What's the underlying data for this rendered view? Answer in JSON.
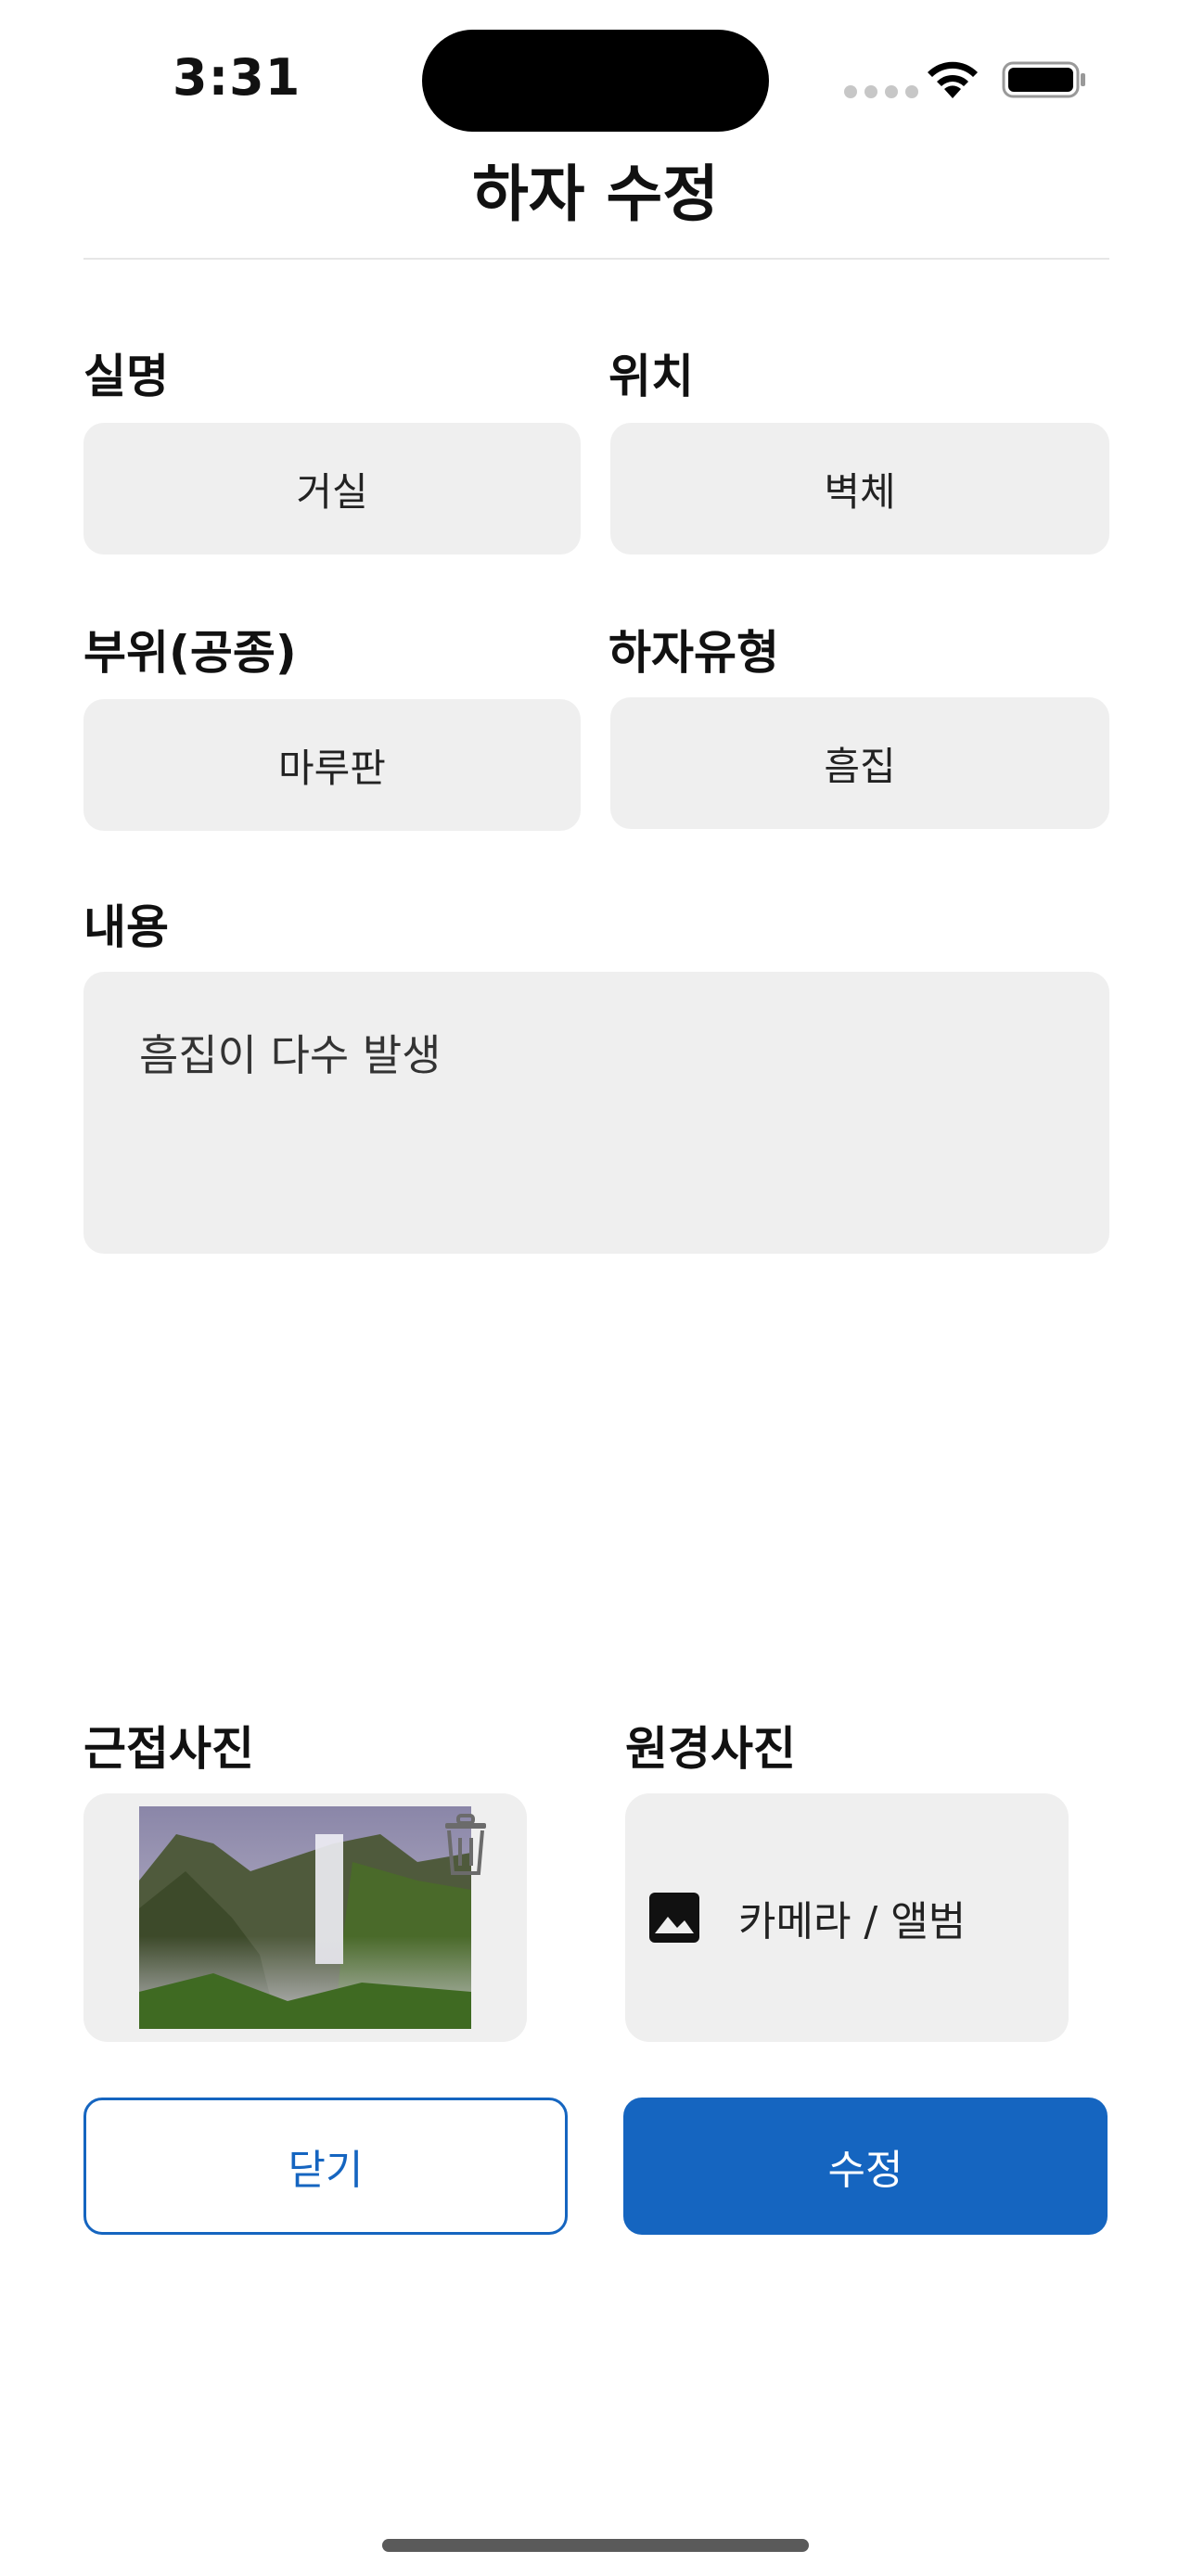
{
  "status_bar": {
    "time": "3:31"
  },
  "header": {
    "title": "하자 수정"
  },
  "form": {
    "room": {
      "label": "실명",
      "value": "거실"
    },
    "location": {
      "label": "위치",
      "value": "벽체"
    },
    "part": {
      "label": "부위(공종)",
      "value": "마루판"
    },
    "defect_type": {
      "label": "하자유형",
      "value": "흠집"
    },
    "content": {
      "label": "내용",
      "value": "흠집이 다수 발생"
    }
  },
  "photos": {
    "closeup": {
      "label": "근접사진"
    },
    "distant": {
      "label": "원경사진",
      "placeholder": "카메라 / 앨범"
    }
  },
  "actions": {
    "close_label": "닫기",
    "edit_label": "수정"
  },
  "colors": {
    "accent": "#1565c0",
    "field_bg": "#efefef"
  },
  "icons": {
    "delete": "trash-icon",
    "picker": "image-icon"
  }
}
